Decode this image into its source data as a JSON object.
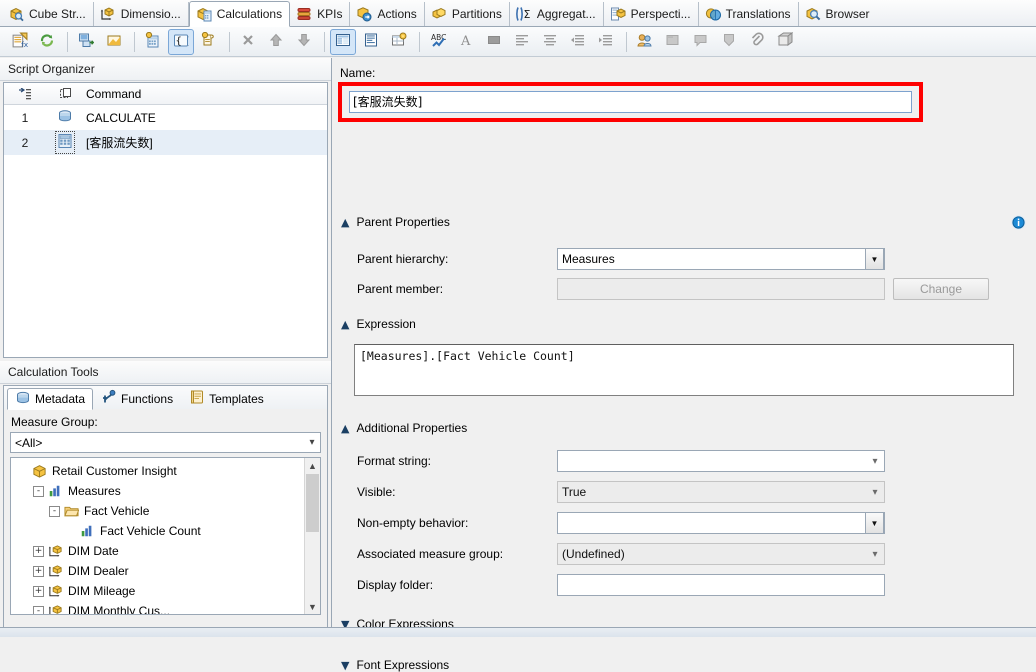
{
  "tabs": [
    {
      "label": "Cube Str...",
      "icon": "cube-search-icon",
      "active": false
    },
    {
      "label": "Dimensio...",
      "icon": "dimension-icon",
      "active": false
    },
    {
      "label": "Calculations",
      "icon": "calculations-icon",
      "active": true
    },
    {
      "label": "KPIs",
      "icon": "kpi-icon",
      "active": false
    },
    {
      "label": "Actions",
      "icon": "actions-icon",
      "active": false
    },
    {
      "label": "Partitions",
      "icon": "partitions-icon",
      "active": false
    },
    {
      "label": "Aggregat...",
      "icon": "aggregations-icon",
      "active": false
    },
    {
      "label": "Perspecti...",
      "icon": "perspectives-icon",
      "active": false
    },
    {
      "label": "Translations",
      "icon": "translations-icon",
      "active": false
    },
    {
      "label": "Browser",
      "icon": "browser-icon",
      "active": false
    }
  ],
  "toolbar": {
    "buttons": [
      {
        "name": "new-calculated-member-icon"
      },
      {
        "name": "refresh-icon"
      },
      {
        "name": "sep"
      },
      {
        "name": "new-script-command-icon"
      },
      {
        "name": "new-named-set-icon"
      },
      {
        "name": "sep"
      },
      {
        "name": "new-calculated-member2-icon"
      },
      {
        "name": "new-named-set2-icon"
      },
      {
        "name": "new-script-icon"
      },
      {
        "name": "sep"
      },
      {
        "name": "delete-icon"
      },
      {
        "name": "move-up-icon"
      },
      {
        "name": "move-down-icon"
      },
      {
        "name": "sep"
      },
      {
        "name": "form-view-icon"
      },
      {
        "name": "script-view-icon"
      },
      {
        "name": "calculation-properties-icon"
      },
      {
        "name": "sep"
      },
      {
        "name": "spell-check-icon"
      },
      {
        "name": "font-icon"
      },
      {
        "name": "color-icon"
      },
      {
        "name": "align-left-icon"
      },
      {
        "name": "align-center-icon"
      },
      {
        "name": "indent-decrease-icon"
      },
      {
        "name": "indent-increase-icon"
      },
      {
        "name": "sep"
      },
      {
        "name": "roles-icon"
      },
      {
        "name": "comment-icon"
      },
      {
        "name": "uncomment-icon"
      },
      {
        "name": "bookmark-icon"
      },
      {
        "name": "attach-icon"
      },
      {
        "name": "deploy-icon"
      }
    ]
  },
  "script_organizer": {
    "caption": "Script Organizer",
    "columns": {
      "index": "",
      "icon": "",
      "command": "Command"
    },
    "rows": [
      {
        "index": "1",
        "label": "CALCULATE",
        "icon": "calculate-icon",
        "selected": false
      },
      {
        "index": "2",
        "label": "[客服流失数]",
        "icon": "calculated-member-icon",
        "selected": true
      }
    ]
  },
  "calculation_tools": {
    "caption": "Calculation Tools",
    "tabs": [
      {
        "label": "Metadata",
        "icon": "metadata-icon",
        "active": true
      },
      {
        "label": "Functions",
        "icon": "functions-icon",
        "active": false
      },
      {
        "label": "Templates",
        "icon": "templates-icon",
        "active": false
      }
    ],
    "measure_group_label": "Measure Group:",
    "measure_group_value": "<All>",
    "tree": [
      {
        "indent": 0,
        "expander": "",
        "icon": "cube-icon",
        "label": "Retail Customer Insight"
      },
      {
        "indent": 1,
        "expander": "-",
        "icon": "measures-icon",
        "label": "Measures"
      },
      {
        "indent": 2,
        "expander": "-",
        "icon": "folder-icon",
        "label": "Fact Vehicle"
      },
      {
        "indent": 3,
        "expander": "",
        "icon": "measure-icon",
        "label": "Fact Vehicle Count"
      },
      {
        "indent": 1,
        "expander": "+",
        "icon": "dimension-tree-icon",
        "label": "DIM Date"
      },
      {
        "indent": 1,
        "expander": "+",
        "icon": "dimension-tree-icon",
        "label": "DIM Dealer"
      },
      {
        "indent": 1,
        "expander": "+",
        "icon": "dimension-tree-icon",
        "label": "DIM Mileage"
      },
      {
        "indent": 1,
        "expander": "-",
        "icon": "dimension-tree-icon",
        "label": "DIM Monthly Cus..."
      }
    ]
  },
  "details": {
    "name_label": "Name:",
    "name_value": "[客服流失数]",
    "parent_properties": {
      "title": "Parent Properties",
      "parent_hierarchy_label": "Parent hierarchy:",
      "parent_hierarchy_value": "Measures",
      "parent_member_label": "Parent member:",
      "parent_member_value": "",
      "change_button": "Change"
    },
    "expression": {
      "title": "Expression",
      "value": "[Measures].[Fact Vehicle Count]"
    },
    "additional_properties": {
      "title": "Additional Properties",
      "format_string_label": "Format string:",
      "format_string_value": "",
      "visible_label": "Visible:",
      "visible_value": "True",
      "non_empty_label": "Non-empty behavior:",
      "non_empty_value": "",
      "assoc_group_label": "Associated measure group:",
      "assoc_group_value": "(Undefined)",
      "display_folder_label": "Display folder:",
      "display_folder_value": ""
    },
    "color_expressions_title": "Color Expressions",
    "font_expressions_title": "Font Expressions",
    "info_icon": "info-icon",
    "highlight_color": "#fe0000"
  }
}
